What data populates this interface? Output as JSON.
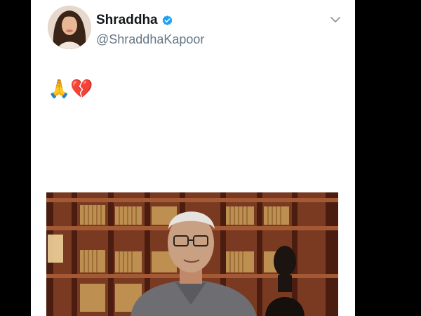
{
  "tweet": {
    "author": {
      "display_name": "Shraddha",
      "handle": "@ShraddhaKapoor",
      "verified": true,
      "verified_icon": "verified-badge-icon",
      "verified_color": "#1da1f2"
    },
    "text": "🙏💔",
    "menu_icon": "chevron-down-icon",
    "media": {
      "kind": "photo",
      "description_icon": "photo"
    }
  },
  "colors": {
    "background": "#000000",
    "card": "#ffffff",
    "name": "#14171a",
    "handle": "#657786"
  }
}
